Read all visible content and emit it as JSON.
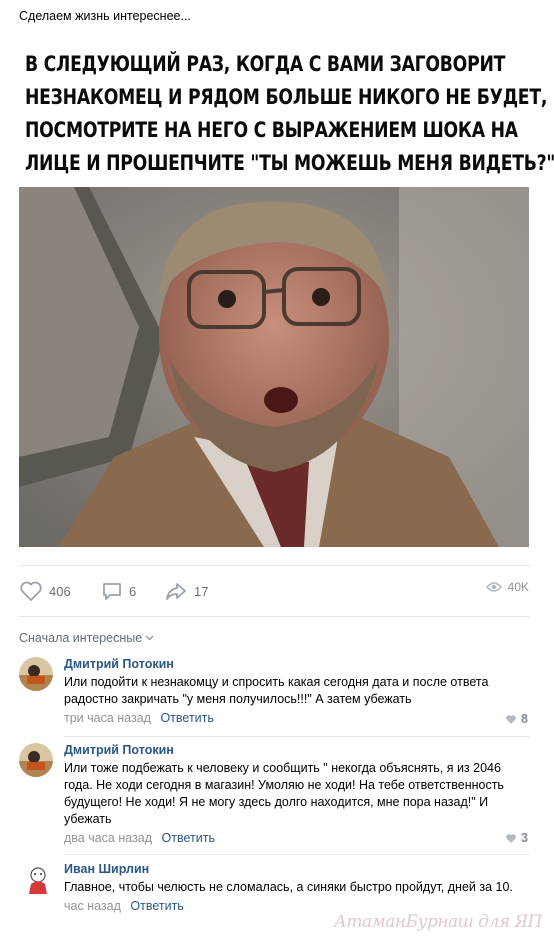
{
  "post": {
    "text": "Сделаем жизнь интереснее...",
    "meme_caption": "В СЛЕДУЮЩИЙ РАЗ, КОГДА С ВАМИ ЗАГОВОРИТ\nНЕЗНАКОМЕЦ И РЯДОМ БОЛЬШЕ НИКОГО НЕ БУДЕТ,\nПОСМОТРИТЕ НА НЕГО С ВЫРАЖЕНИЕМ ШОКА НА\nЛИЦЕ И ПРОШЕПЧИТЕ \"ТЫ МОЖЕШЬ МЕНЯ ВИДЕТЬ?\""
  },
  "actions": {
    "likes": "406",
    "comments": "6",
    "shares": "17",
    "views": "40K"
  },
  "comments_section": {
    "sort_label": "Сначала интересные",
    "items": [
      {
        "author": "Дмитрий Потокин",
        "text": "Или подойти к незнакомцу и спросить какая сегодня дата и после ответа радостно закричать \"у меня получилось!!!\" А затем убежать",
        "time": "три часа назад",
        "reply": "Ответить",
        "likes": "8"
      },
      {
        "author": "Дмитрий Потокин",
        "text": "Или тоже подбежать к человеку и сообщить \" некогда объяснять, я из 2046 года. Не ходи сегодня в магазин! Умоляю не ходи! На тебе ответственность будущего! Не ходи! Я не могу здесь долго находится, мне пора назад!\" И убежать",
        "time": "два часа назад",
        "reply": "Ответить",
        "likes": "3"
      },
      {
        "author": "Иван Ширлин",
        "text": "Главное, чтобы челюсть не сломалась, а синяки быстро пройдут, дней за 10.",
        "time": "час назад",
        "reply": "Ответить"
      }
    ]
  },
  "watermark": "АтаманБурнаш для ЯП",
  "colors": {
    "link": "#2a5885",
    "meta": "#939393",
    "icon": "#99a2ad",
    "divider": "#e7e8ec"
  }
}
